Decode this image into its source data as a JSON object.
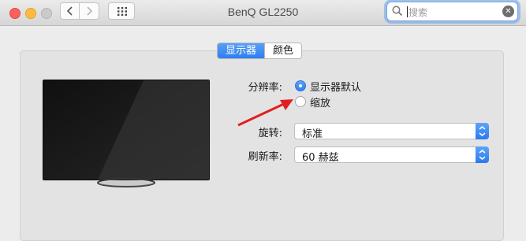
{
  "window": {
    "title": "BenQ GL2250",
    "search_placeholder": "搜索"
  },
  "tabs": [
    {
      "label": "显示器",
      "active": true
    },
    {
      "label": "颜色",
      "active": false
    }
  ],
  "settings": {
    "resolution_label": "分辨率:",
    "resolution_options": [
      {
        "label": "显示器默认",
        "selected": true
      },
      {
        "label": "缩放",
        "selected": false
      }
    ],
    "rotation_label": "旋转:",
    "rotation_value": "标准",
    "refresh_label": "刷新率:",
    "refresh_value": "60 赫兹"
  },
  "colors": {
    "accent": "#2f7ef0",
    "annotation_arrow": "#e02020"
  }
}
